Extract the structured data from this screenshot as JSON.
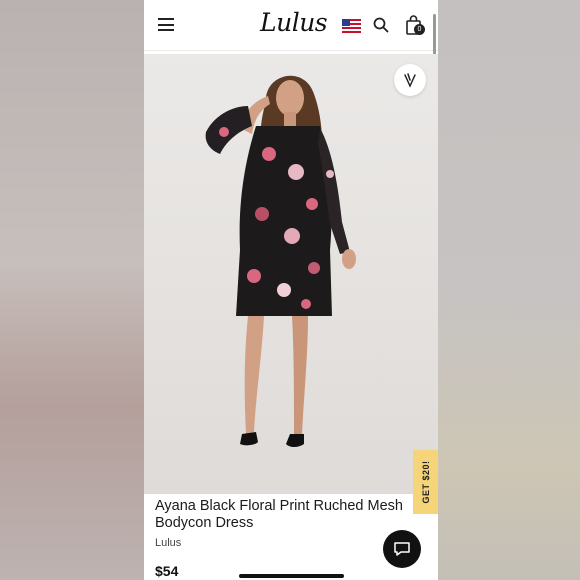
{
  "header": {
    "logo_text": "Lulus",
    "bag_count": "0"
  },
  "product": {
    "title": "Ayana Black Floral Print Ruched Mesh Bodycon Dress",
    "brand": "Lulus",
    "price": "$54",
    "gallery_slides": 3,
    "gallery_active_index": 2
  },
  "promo": {
    "label": "GET $20!"
  },
  "icons": {
    "menu": "hamburger-menu-icon",
    "flag": "us-flag-icon",
    "search": "search-icon",
    "bag": "shopping-bag-icon",
    "wishlist": "heart-wishlist-icon",
    "chat": "chat-icon"
  },
  "colors": {
    "promo_bg": "#f6d57a",
    "chat_bg": "#111111",
    "dress_dark": "#1d1a1c",
    "floral_pink": "#d9677f"
  }
}
